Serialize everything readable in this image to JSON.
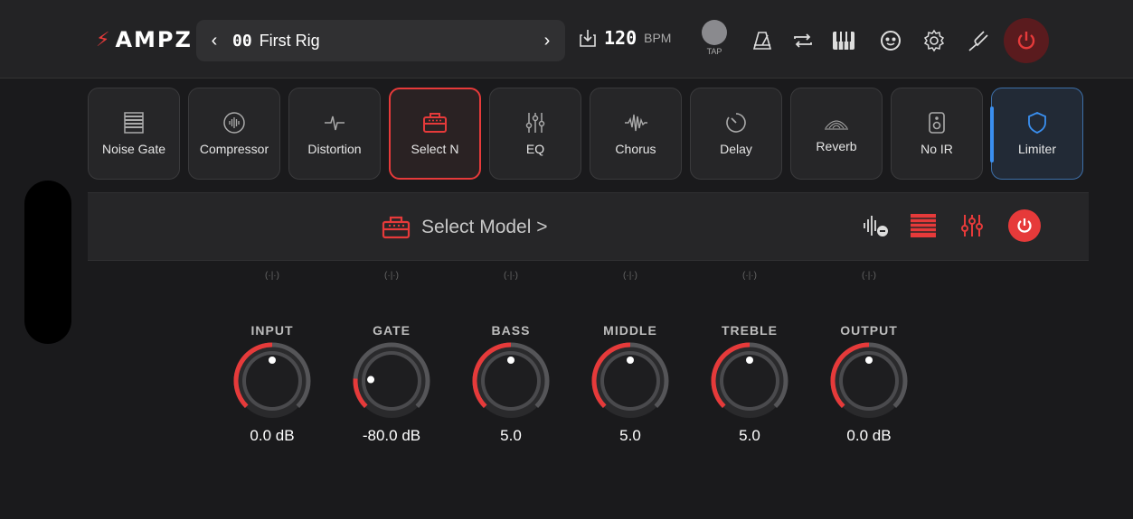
{
  "app": {
    "logo_text": "AMPZ",
    "logo_icon": "bolt-icon",
    "accent": "#e63a3a",
    "selection_blue": "#3a8ff0"
  },
  "preset": {
    "prev_icon": "chevron-left-icon",
    "number": "00",
    "name": "First Rig",
    "next_icon": "chevron-right-icon"
  },
  "tempo": {
    "icon": "import-icon",
    "value": "120",
    "unit": "BPM",
    "tap_label": "TAP"
  },
  "toolbar_icons": [
    "metronome-icon",
    "loop-icon",
    "piano-icon",
    "mask-icon",
    "gear-icon",
    "tuner-fork-icon",
    "power-icon"
  ],
  "effects": [
    {
      "label": "Noise Gate",
      "icon": "noise-gate-icon",
      "state": "normal"
    },
    {
      "label": "Compressor",
      "icon": "compressor-icon",
      "state": "normal"
    },
    {
      "label": "Distortion",
      "icon": "distortion-icon",
      "state": "normal"
    },
    {
      "label": "Select N",
      "icon": "amp-icon",
      "state": "selected"
    },
    {
      "label": "EQ",
      "icon": "eq-sliders-icon",
      "state": "normal"
    },
    {
      "label": "Chorus",
      "icon": "waveform-icon",
      "state": "normal"
    },
    {
      "label": "Delay",
      "icon": "timer-icon",
      "state": "normal"
    },
    {
      "label": "Reverb",
      "icon": "reverb-icon",
      "state": "normal"
    },
    {
      "label": "No IR",
      "icon": "speaker-icon",
      "state": "normal"
    },
    {
      "label": "Limiter",
      "icon": "shield-icon",
      "state": "focused"
    }
  ],
  "model_bar": {
    "label": "Select Model >",
    "icons": [
      "waveform-minus-icon",
      "noise-gate-icon",
      "eq-sliders-icon",
      "power-icon"
    ]
  },
  "knobs": [
    {
      "label": "INPUT",
      "value": "0.0 dB",
      "level": 0.5
    },
    {
      "label": "GATE",
      "value": "-80.0 dB",
      "level": 0.18
    },
    {
      "label": "BASS",
      "value": "5.0",
      "level": 0.5
    },
    {
      "label": "MIDDLE",
      "value": "5.0",
      "level": 0.5
    },
    {
      "label": "TREBLE",
      "value": "5.0",
      "level": 0.5
    },
    {
      "label": "OUTPUT",
      "value": "0.0 dB",
      "level": 0.5
    }
  ]
}
